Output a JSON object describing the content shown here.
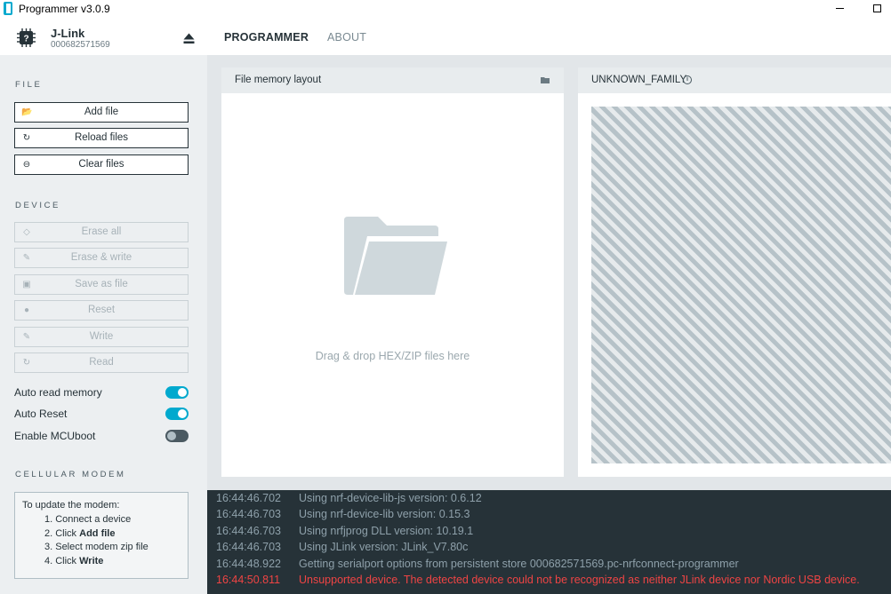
{
  "window": {
    "title": "Programmer v3.0.9"
  },
  "device": {
    "name": "J-Link",
    "serial": "000682571569"
  },
  "nav": {
    "tabs": [
      {
        "label": "PROGRAMMER",
        "active": true
      },
      {
        "label": "ABOUT",
        "active": false
      }
    ]
  },
  "sidebar": {
    "file_section_title": "FILE",
    "file_buttons": [
      {
        "label": "Add file",
        "icon": "folder-icon",
        "enabled": true
      },
      {
        "label": "Reload files",
        "icon": "refresh-icon",
        "enabled": true
      },
      {
        "label": "Clear files",
        "icon": "minus-circle-icon",
        "enabled": true
      }
    ],
    "device_section_title": "DEVICE",
    "device_buttons": [
      {
        "label": "Erase all",
        "icon": "eraser-icon",
        "enabled": false
      },
      {
        "label": "Erase & write",
        "icon": "pencil-icon",
        "enabled": false
      },
      {
        "label": "Save as file",
        "icon": "save-icon",
        "enabled": false
      },
      {
        "label": "Reset",
        "icon": "dot-icon",
        "enabled": false
      },
      {
        "label": "Write",
        "icon": "pencil-icon",
        "enabled": false
      },
      {
        "label": "Read",
        "icon": "refresh-icon",
        "enabled": false
      }
    ],
    "toggles": [
      {
        "label": "Auto read memory",
        "on": true
      },
      {
        "label": "Auto Reset",
        "on": true
      },
      {
        "label": "Enable MCUboot",
        "on": false
      }
    ],
    "modem_section_title": "CELLULAR MODEM",
    "modem_info": {
      "intro": "To update the modem:",
      "step1": "1. Connect a device",
      "step2_prefix": "2. Click ",
      "step2_bold": "Add file",
      "step3": "3. Select modem zip file",
      "step4_prefix": "4. Click ",
      "step4_bold": "Write"
    }
  },
  "main": {
    "file_card": {
      "title": "File memory layout",
      "drop_text": "Drag & drop HEX/ZIP files here"
    },
    "device_card": {
      "title": "UNKNOWN_FAMILY"
    }
  },
  "log": [
    {
      "time": "16:44:46.702",
      "message": "Using nrf-device-lib-js version: 0.6.12",
      "level": "info"
    },
    {
      "time": "16:44:46.703",
      "message": "Using nrf-device-lib version: 0.15.3",
      "level": "info"
    },
    {
      "time": "16:44:46.703",
      "message": "Using nrfjprog DLL version: 10.19.1",
      "level": "info"
    },
    {
      "time": "16:44:46.703",
      "message": "Using JLink version: JLink_V7.80c",
      "level": "info"
    },
    {
      "time": "16:44:48.922",
      "message": "Getting serialport options from persistent store 000682571569.pc-nrfconnect-programmer",
      "level": "info"
    },
    {
      "time": "16:44:50.811",
      "message": "Unsupported device. The detected device could not be recognized as neither JLink device nor Nordic USB device.",
      "level": "error"
    }
  ],
  "colors": {
    "accent": "#00a9ce",
    "sidebar_bg": "#eceff1",
    "log_bg": "#263238",
    "error": "#ef4444"
  }
}
